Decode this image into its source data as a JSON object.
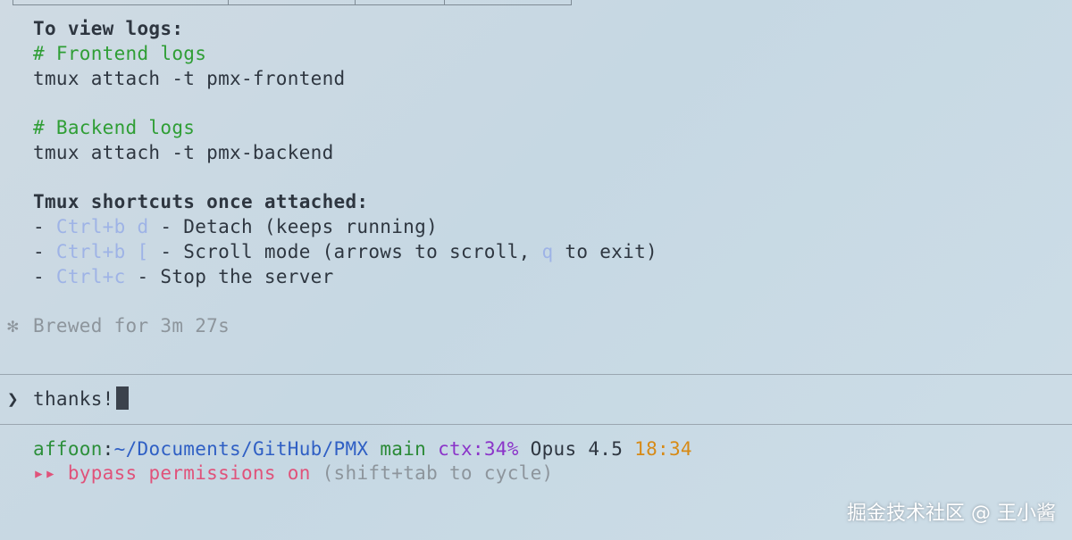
{
  "output": {
    "view_logs_heading": "To view logs:",
    "frontend_comment": "# Frontend logs",
    "frontend_cmd": "tmux attach -t pmx-frontend",
    "backend_comment": "# Backend logs",
    "backend_cmd": "tmux attach -t pmx-backend",
    "shortcuts_heading": "Tmux shortcuts once attached:",
    "shortcuts": [
      {
        "bullet": "- ",
        "key": "Ctrl+b d",
        "desc": " - Detach (keeps running)"
      },
      {
        "bullet": "- ",
        "key": "Ctrl+b [",
        "desc_a": " - Scroll mode (arrows to scroll, ",
        "key2": "q",
        "desc_b": " to exit)"
      },
      {
        "bullet": "- ",
        "key": "Ctrl+c",
        "desc": " - Stop the server"
      }
    ]
  },
  "status": {
    "spinner_glyph": "✻",
    "brewed_text": "Brewed for 3m 27s"
  },
  "prompt": {
    "chevron": "❯",
    "input_value": "thanks!"
  },
  "statusline": {
    "user": "affoon",
    "colon": ":",
    "path": "~/Documents/GitHub/PMX",
    "branch": "main",
    "ctx": "ctx:34%",
    "model": "Opus 4.5",
    "time": "18:34",
    "bypass_arrows": "▸▸",
    "bypass_text": "bypass permissions on",
    "bypass_hint": "(shift+tab to cycle)"
  },
  "watermark": "掘金技术社区 @ 王小酱",
  "colors": {
    "comment": "#2f9e35",
    "key": "#9eb3e6",
    "path": "#2f5fc4",
    "ctx": "#8b34c9",
    "time": "#d78a16",
    "bypass": "#e0527a"
  }
}
